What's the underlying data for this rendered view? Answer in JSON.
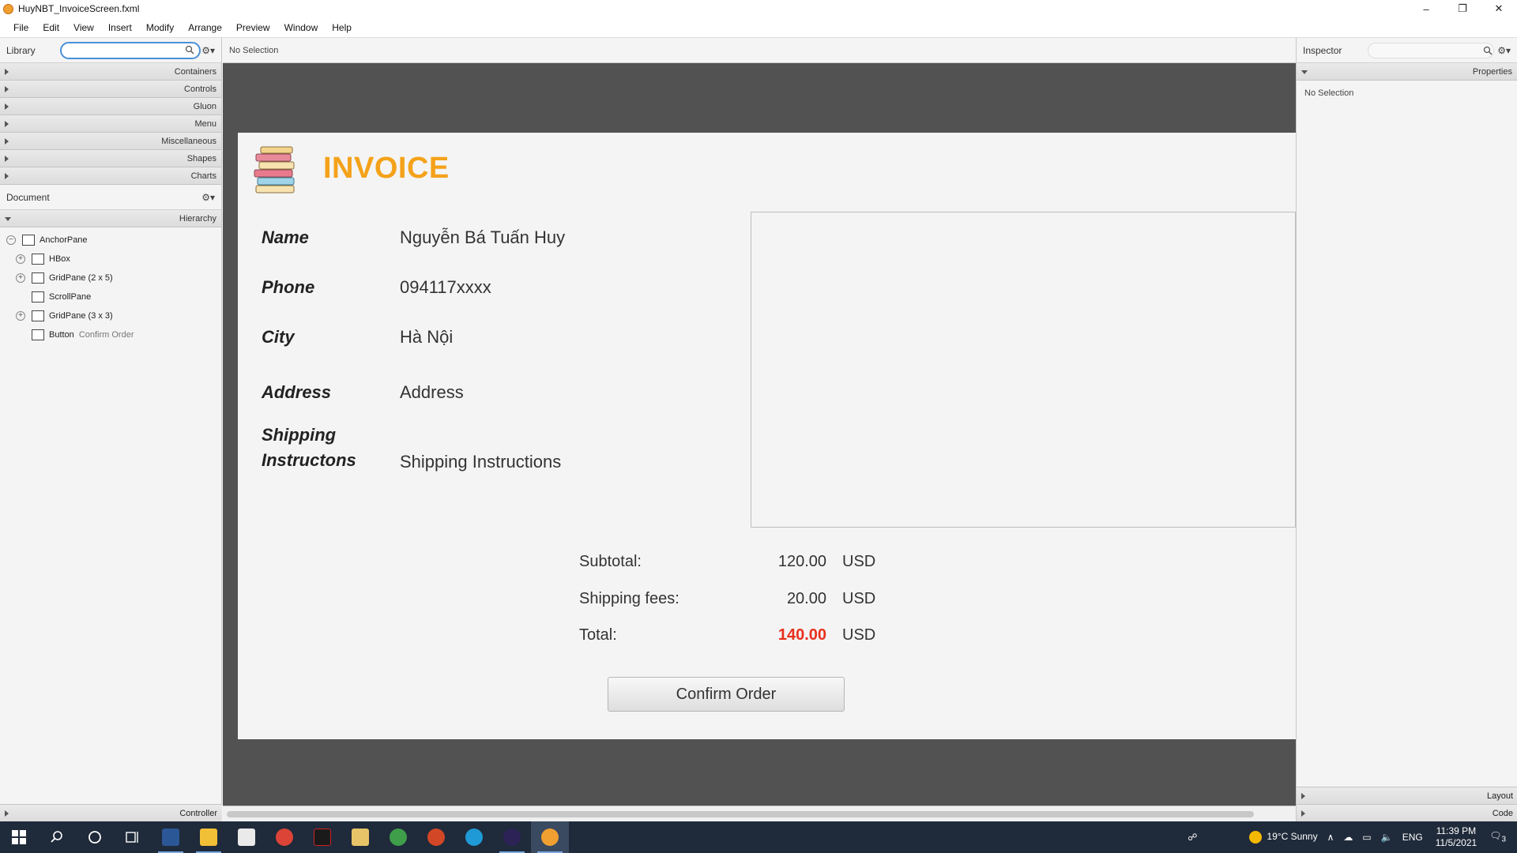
{
  "window": {
    "title": "HuyNBT_InvoiceScreen.fxml",
    "controls": [
      "–",
      "❐",
      "✕"
    ]
  },
  "menu": [
    "File",
    "Edit",
    "View",
    "Insert",
    "Modify",
    "Arrange",
    "Preview",
    "Window",
    "Help"
  ],
  "library": {
    "header": "Library",
    "search_value": "",
    "sections": [
      "Containers",
      "Controls",
      "Gluon",
      "Menu",
      "Miscellaneous",
      "Shapes",
      "Charts"
    ]
  },
  "document": {
    "header": "Document",
    "hierarchy_label": "Hierarchy",
    "tree": [
      {
        "label": "AnchorPane",
        "sub": "",
        "icon": "anchorpane-icon"
      },
      {
        "label": "HBox",
        "sub": "",
        "icon": "hbox-icon"
      },
      {
        "label": "GridPane (2 x 5)",
        "sub": "",
        "icon": "gridpane-icon"
      },
      {
        "label": "ScrollPane",
        "sub": "",
        "icon": "scrollpane-icon"
      },
      {
        "label": "GridPane (3 x 3)",
        "sub": "",
        "icon": "gridpane-icon"
      },
      {
        "label": "Button",
        "sub": "Confirm Order",
        "icon": "button-icon"
      }
    ],
    "controller_label": "Controller"
  },
  "center": {
    "selection_status": "No Selection"
  },
  "invoice": {
    "title": "INVOICE",
    "fields": [
      {
        "label": "Name",
        "value": "Nguyễn Bá Tuấn Huy"
      },
      {
        "label": "Phone",
        "value": "094117xxxx"
      },
      {
        "label": "City",
        "value": "Hà Nội"
      },
      {
        "label": "Address",
        "value": "Address"
      },
      {
        "label_line1": "Shipping",
        "label_line2": "Instructons",
        "value": "Shipping Instructions"
      }
    ],
    "summary": {
      "subtotal_label": "Subtotal:",
      "subtotal_value": "120.00",
      "shipping_label": "Shipping fees:",
      "shipping_value": "20.00",
      "total_label": "Total:",
      "total_value": "140.00",
      "currency": "USD"
    },
    "confirm_button": "Confirm Order",
    "colors": {
      "title": "#f4a21a",
      "total": "#e8301c"
    }
  },
  "inspector": {
    "header": "Inspector",
    "properties_label": "Properties",
    "no_selection": "No Selection",
    "layout_label": "Layout",
    "code_label": "Code"
  },
  "taskbar": {
    "weather": "19°C  Sunny",
    "language": "ENG",
    "time": "11:39 PM",
    "date": "11/5/2021",
    "notification_count": "3"
  }
}
